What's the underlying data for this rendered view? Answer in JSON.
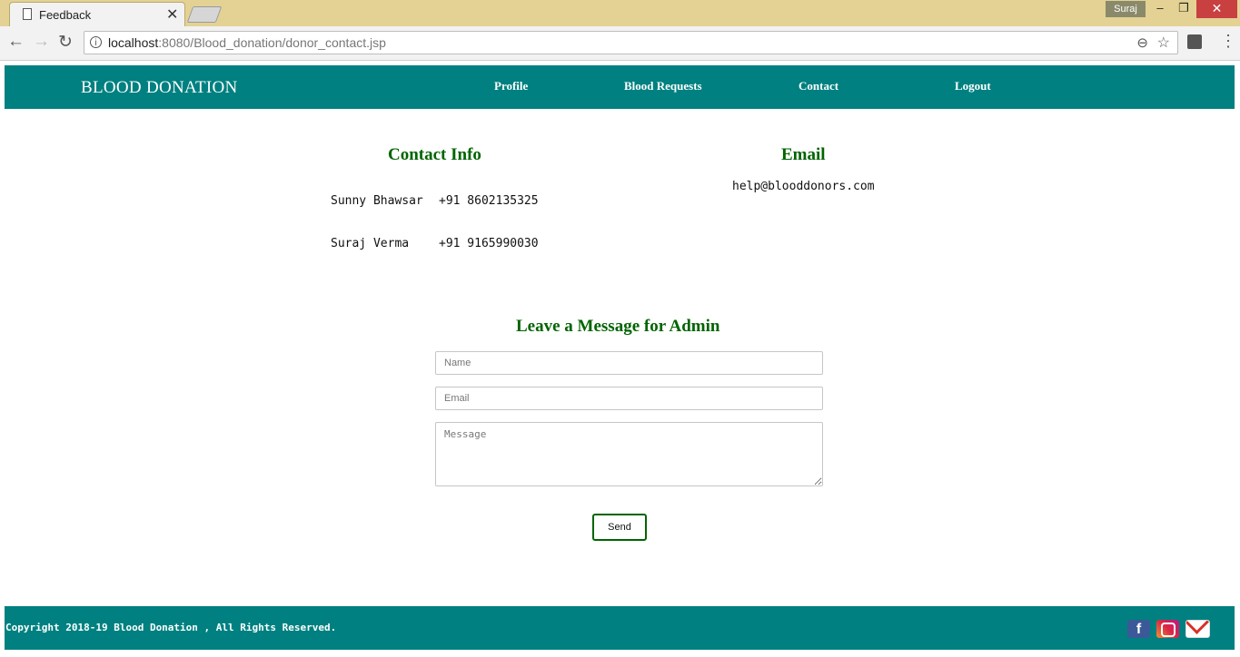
{
  "browser": {
    "tab_title": "Feedback",
    "tab_close": "✕",
    "user": "Suraj",
    "url_host": "localhost",
    "url_path": ":8080/Blood_donation/donor_contact.jsp",
    "window_min": "–",
    "window_max": "❐",
    "window_close": "✕",
    "back": "←",
    "forward": "→",
    "reload": "↻",
    "info": "i",
    "zoom": "⊖",
    "star": "☆",
    "menu": "⋮",
    "icons": [
      "page-icon",
      "back-icon",
      "forward-icon",
      "reload-icon",
      "info-icon",
      "zoom-icon",
      "star-icon",
      "extension-icon",
      "menu-icon"
    ]
  },
  "header": {
    "brand": "BLOOD DONATION",
    "nav": [
      "Profile",
      "Blood Requests",
      "Contact",
      "Logout"
    ],
    "background": "#008080"
  },
  "contact": {
    "heading": "Contact Info",
    "people": [
      {
        "name": "Sunny Bhawsar",
        "phone": "+91 8602135325"
      },
      {
        "name": "Suraj Verma",
        "phone": "+91 9165990030"
      }
    ]
  },
  "email": {
    "heading": "Email",
    "address": "help@blooddonors.com"
  },
  "form": {
    "heading": "Leave a Message for Admin",
    "name_placeholder": "Name",
    "email_placeholder": "Email",
    "message_placeholder": "Message",
    "send_label": "Send"
  },
  "footer": {
    "copyright": "Copyright 2018-19 Blood Donation , All Rights Reserved.",
    "social": [
      "facebook-icon",
      "instagram-icon",
      "gmail-icon"
    ],
    "fb_glyph": "f"
  },
  "colors": {
    "accent": "#008080",
    "heading": "#006400",
    "titlebar": "#e3d294"
  }
}
